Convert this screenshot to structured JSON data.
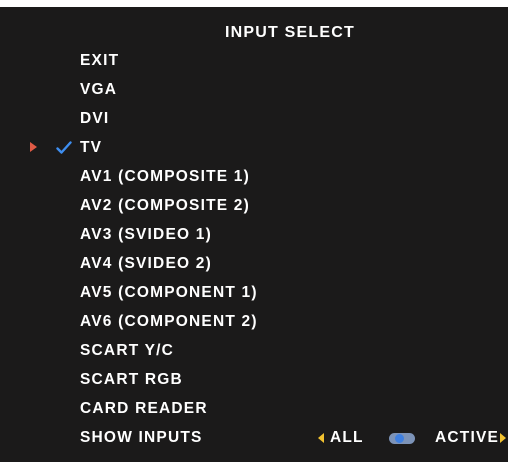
{
  "title": "INPUT SELECT",
  "menu_items": [
    {
      "label": "EXIT"
    },
    {
      "label": "VGA"
    },
    {
      "label": "DVI"
    },
    {
      "label": "TV",
      "selected": true,
      "checked": true
    },
    {
      "label": "AV1 (COMPOSITE 1)"
    },
    {
      "label": "AV2 (COMPOSITE 2)"
    },
    {
      "label": "AV3 (SVIDEO 1)"
    },
    {
      "label": "AV4 (SVIDEO 2)"
    },
    {
      "label": "AV5 (COMPONENT 1)"
    },
    {
      "label": "AV6 (COMPONENT 2)"
    },
    {
      "label": "SCART Y/C"
    },
    {
      "label": "SCART RGB"
    },
    {
      "label": "CARD READER"
    }
  ],
  "show_inputs": {
    "label": "SHOW INPUTS",
    "option_all": "ALL",
    "option_active": "ACTIVE",
    "toggle_position": "all"
  },
  "icons": {
    "selection_pointer": "right-triangle-pointer-icon",
    "current_input_check": "checkmark-icon",
    "option_left": "left-arrow-icon",
    "option_right": "right-arrow-icon",
    "toggle": "toggle-switch-icon"
  },
  "colors": {
    "background": "#1b1a1a",
    "text": "#ffffff",
    "pointer": "#e05a45",
    "check": "#3e8ef0",
    "option_arrows": "#f2c230",
    "toggle_track": "#7c93b8",
    "toggle_knob": "#3e7fe0"
  }
}
